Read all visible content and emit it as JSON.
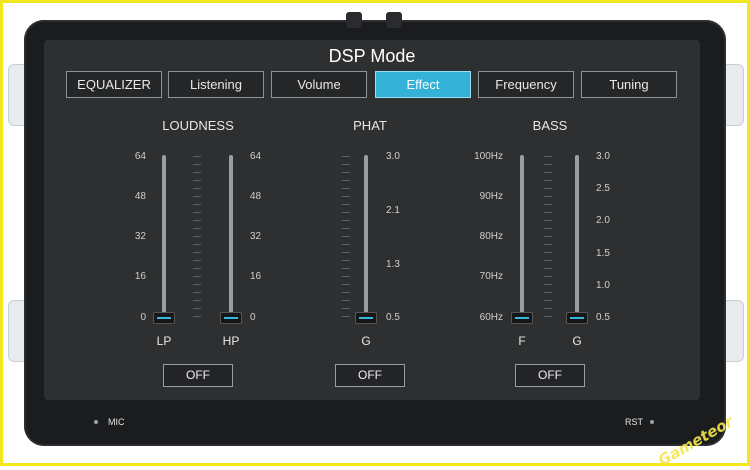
{
  "screen_title": "DSP Mode",
  "tabs": [
    {
      "label": "EQUALIZER"
    },
    {
      "label": "Listening"
    },
    {
      "label": "Volume"
    },
    {
      "label": "Effect",
      "active": true
    },
    {
      "label": "Frequency"
    },
    {
      "label": "Tuning"
    }
  ],
  "loudness": {
    "title": "LOUDNESS",
    "left_scale": [
      "64",
      "48",
      "32",
      "16",
      "0"
    ],
    "right_scale": [
      "64",
      "48",
      "32",
      "16",
      "0"
    ],
    "lp_label": "LP",
    "hp_label": "HP",
    "lp_value": 0,
    "hp_value": 0,
    "button": "OFF"
  },
  "phat": {
    "title": "PHAT",
    "scale": [
      "3.0",
      "2.1",
      "1.3",
      "0.5"
    ],
    "g_label": "G",
    "g_value": 0.5,
    "button": "OFF"
  },
  "bass": {
    "title": "BASS",
    "left_scale": [
      "100Hz",
      "90Hz",
      "80Hz",
      "70Hz",
      "60Hz"
    ],
    "right_scale": [
      "3.0",
      "2.5",
      "2.0",
      "1.5",
      "1.0",
      "0.5"
    ],
    "f_label": "F",
    "g_label": "G",
    "f_value": "60Hz",
    "g_value": 0.5,
    "button": "OFF"
  },
  "hardware": {
    "mic_label": "MIC",
    "rst_label": "RST"
  },
  "watermark": "Gameteor",
  "colors": {
    "accent": "#33b1d6",
    "frame": "#f2e61c"
  }
}
